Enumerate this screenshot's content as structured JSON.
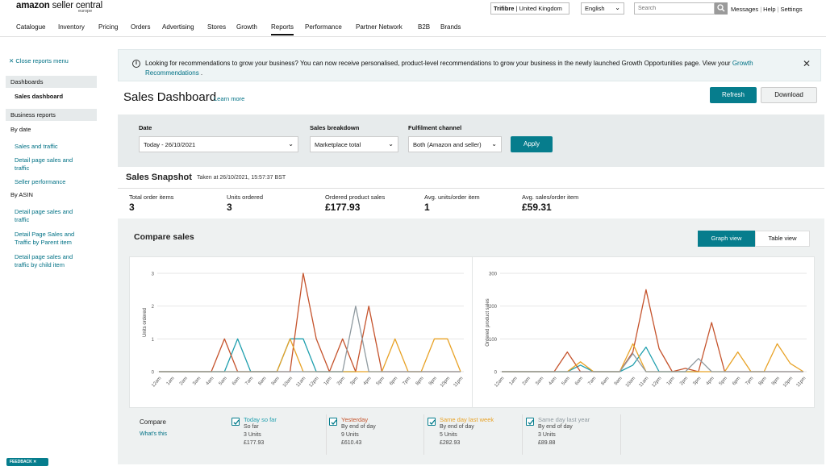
{
  "header": {
    "logo_main": "amazon",
    "logo_sub": " seller central",
    "logo_region": "europe",
    "store_name": "Trifibre",
    "store_country": " | United Kingdom",
    "language": "English",
    "search_placeholder": "Search",
    "links": [
      "Messages",
      "Help",
      "Settings"
    ]
  },
  "nav": {
    "items": [
      "Catalogue",
      "Inventory",
      "Pricing",
      "Orders",
      "Advertising",
      "Stores",
      "Growth",
      "Reports",
      "Performance",
      "Partner Network",
      "B2B",
      "Brands"
    ],
    "active": "Reports"
  },
  "sidebar": {
    "close_menu": "Close reports menu",
    "dashboards_heading": "Dashboards",
    "sales_dashboard": "Sales dashboard",
    "business_reports_heading": "Business reports",
    "by_date_label": "By date",
    "by_date_links": [
      "Sales and traffic",
      "Detail page sales and traffic",
      "Seller performance"
    ],
    "by_asin_label": "By ASIN",
    "by_asin_links": [
      "Detail page sales and traffic",
      "Detail Page Sales and Traffic by Parent item",
      "Detail page sales and traffic by child item"
    ],
    "feedback": "FEEDBACK"
  },
  "banner": {
    "text": "Looking for recommendations to grow your business? You can now receive personalised, product-level recommendations to grow your business in the newly launched Growth Opportunities page. View your ",
    "link": "Growth Recommendations",
    "suffix": " ."
  },
  "page": {
    "title": "Sales Dashboard",
    "learn_more": "Learn more",
    "refresh": "Refresh",
    "download": "Download"
  },
  "filters": {
    "date_label": "Date",
    "date_value": "Today - 26/10/2021",
    "breakdown_label": "Sales breakdown",
    "breakdown_value": "Marketplace total",
    "channel_label": "Fulfilment channel",
    "channel_value": "Both (Amazon and seller)",
    "apply": "Apply"
  },
  "snapshot": {
    "title": "Sales Snapshot",
    "taken_at": "Taken at 26/10/2021, 15:57:37 BST",
    "metrics": [
      {
        "label": "Total order items",
        "value": "3"
      },
      {
        "label": "Units ordered",
        "value": "3"
      },
      {
        "label": "Ordered product sales",
        "value": "£177.93"
      },
      {
        "label": "Avg. units/order item",
        "value": "1"
      },
      {
        "label": "Avg. sales/order item",
        "value": "£59.31"
      }
    ]
  },
  "compare": {
    "title": "Compare sales",
    "graph_view": "Graph view",
    "table_view": "Table view",
    "compare_label": "Compare",
    "whats_this": "What's this",
    "legend": [
      {
        "name": "Today so far",
        "period": "So far",
        "units": "3 Units",
        "sales": "£177.93",
        "color": "#1f9fae",
        "checked": true
      },
      {
        "name": "Yesterday",
        "period": "By end of day",
        "units": "9 Units",
        "sales": "£610.43",
        "color": "#c5532c",
        "checked": true
      },
      {
        "name": "Same day last week",
        "period": "By end of day",
        "units": "5 Units",
        "sales": "£282.93",
        "color": "#e8a226",
        "checked": true
      },
      {
        "name": "Same day last year",
        "period": "By end of day",
        "units": "3 Units",
        "sales": "£89.88",
        "color": "#8f9aa0",
        "checked": true
      }
    ]
  },
  "chart_data": [
    {
      "type": "line",
      "ylabel": "Units ordered",
      "ylim": [
        0,
        3
      ],
      "yticks": [
        0,
        1,
        2,
        3
      ],
      "grid": true,
      "x": [
        "12am",
        "1am",
        "2am",
        "3am",
        "4am",
        "5am",
        "6am",
        "7am",
        "8am",
        "9am",
        "10am",
        "11am",
        "12pm",
        "1pm",
        "2pm",
        "3pm",
        "4pm",
        "5pm",
        "6pm",
        "7pm",
        "8pm",
        "9pm",
        "10pm",
        "11pm"
      ],
      "series": [
        {
          "name": "Today so far",
          "color": "#1f9fae",
          "values": [
            0,
            0,
            0,
            0,
            0,
            0,
            1,
            0,
            0,
            0,
            1,
            1,
            0,
            0,
            0,
            0,
            null,
            null,
            null,
            null,
            null,
            null,
            null,
            null
          ]
        },
        {
          "name": "Yesterday",
          "color": "#c5532c",
          "values": [
            0,
            0,
            0,
            0,
            0,
            1,
            0,
            0,
            0,
            0,
            0,
            3,
            1,
            0,
            1,
            0,
            2,
            0,
            0,
            0,
            0,
            0,
            0,
            0
          ]
        },
        {
          "name": "Same day last week",
          "color": "#e8a226",
          "values": [
            0,
            0,
            0,
            0,
            0,
            0,
            0,
            0,
            0,
            0,
            1,
            0,
            0,
            0,
            0,
            0,
            0,
            0,
            1,
            0,
            0,
            1,
            1,
            0
          ]
        },
        {
          "name": "Same day last year",
          "color": "#8f9aa0",
          "values": [
            0,
            0,
            0,
            0,
            0,
            0,
            0,
            0,
            0,
            0,
            0,
            0,
            0,
            0,
            0,
            2,
            0,
            0,
            0,
            0,
            0,
            0,
            0,
            0
          ]
        }
      ]
    },
    {
      "type": "line",
      "ylabel": "Ordered product sales",
      "ylim": [
        0,
        300
      ],
      "yticks": [
        0,
        100,
        200,
        300
      ],
      "grid": true,
      "x": [
        "12am",
        "1am",
        "2am",
        "3am",
        "4am",
        "5am",
        "6am",
        "7am",
        "8am",
        "9am",
        "10am",
        "11am",
        "12pm",
        "1pm",
        "2pm",
        "3pm",
        "4pm",
        "5pm",
        "6pm",
        "7pm",
        "8pm",
        "9pm",
        "10pm",
        "11pm"
      ],
      "series": [
        {
          "name": "Today so far",
          "color": "#1f9fae",
          "values": [
            0,
            0,
            0,
            0,
            0,
            0,
            20,
            0,
            0,
            0,
            20,
            75,
            0,
            0,
            0,
            0,
            null,
            null,
            null,
            null,
            null,
            null,
            null,
            null
          ]
        },
        {
          "name": "Yesterday",
          "color": "#c5532c",
          "values": [
            0,
            0,
            0,
            0,
            0,
            60,
            0,
            0,
            0,
            0,
            60,
            250,
            70,
            0,
            10,
            0,
            150,
            0,
            0,
            0,
            0,
            0,
            0,
            0
          ]
        },
        {
          "name": "Same day last week",
          "color": "#e8a226",
          "values": [
            0,
            0,
            0,
            0,
            0,
            0,
            30,
            0,
            0,
            0,
            85,
            0,
            0,
            0,
            0,
            0,
            0,
            0,
            60,
            0,
            0,
            85,
            25,
            0
          ]
        },
        {
          "name": "Same day last year",
          "color": "#8f9aa0",
          "values": [
            0,
            0,
            0,
            0,
            0,
            0,
            0,
            0,
            0,
            0,
            55,
            0,
            0,
            0,
            0,
            40,
            0,
            0,
            0,
            0,
            0,
            0,
            0,
            0
          ]
        }
      ]
    }
  ]
}
